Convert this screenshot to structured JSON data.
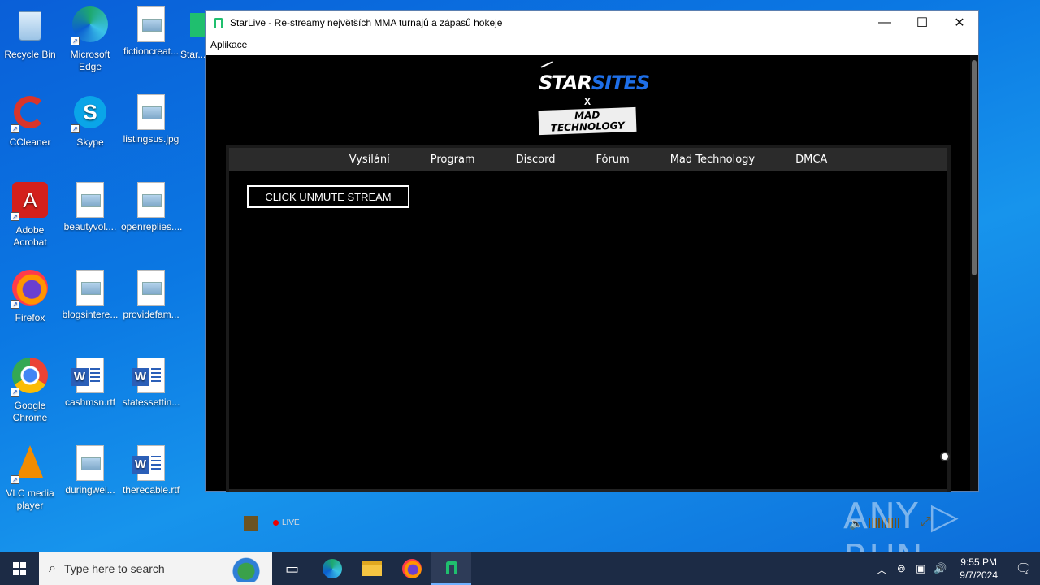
{
  "desktop": {
    "icons": [
      {
        "label": "Recycle Bin"
      },
      {
        "label": "Microsoft Edge"
      },
      {
        "label": "fictioncreat..."
      },
      {
        "label": "Star..."
      },
      {
        "label": "CCleaner"
      },
      {
        "label": "Skype"
      },
      {
        "label": "listingsus.jpg"
      },
      {
        "label": "Adobe Acrobat"
      },
      {
        "label": "beautyvol...."
      },
      {
        "label": "openreplies...."
      },
      {
        "label": "Firefox"
      },
      {
        "label": "blogsintere..."
      },
      {
        "label": "providefam..."
      },
      {
        "label": "Google Chrome"
      },
      {
        "label": "cashmsn.rtf"
      },
      {
        "label": "statessettin..."
      },
      {
        "label": "VLC media player"
      },
      {
        "label": "duringwel..."
      },
      {
        "label": "therecable.rtf"
      }
    ]
  },
  "window": {
    "title": "StarLive - Re-streamy největších MMA turnajů a zápasů hokeje",
    "menu": {
      "app": "Aplikace"
    },
    "buttons": {
      "minimize": "—",
      "maximize": "☐",
      "close": "✕"
    }
  },
  "site": {
    "logo": {
      "star": "STAR",
      "sites": "SITES",
      "x": "X",
      "mad": "MAD TECHNOLOGY"
    },
    "nav": [
      "Vysílání",
      "Program",
      "Discord",
      "Fórum",
      "Mad Technology",
      "DMCA"
    ],
    "unmute_label": "CLICK UNMUTE STREAM",
    "player": {
      "live_label": "LIVE"
    }
  },
  "watermark": "ANY ▷ RUN",
  "taskbar": {
    "search_placeholder": "Type here to search",
    "time": "9:55 PM",
    "date": "9/7/2024"
  }
}
